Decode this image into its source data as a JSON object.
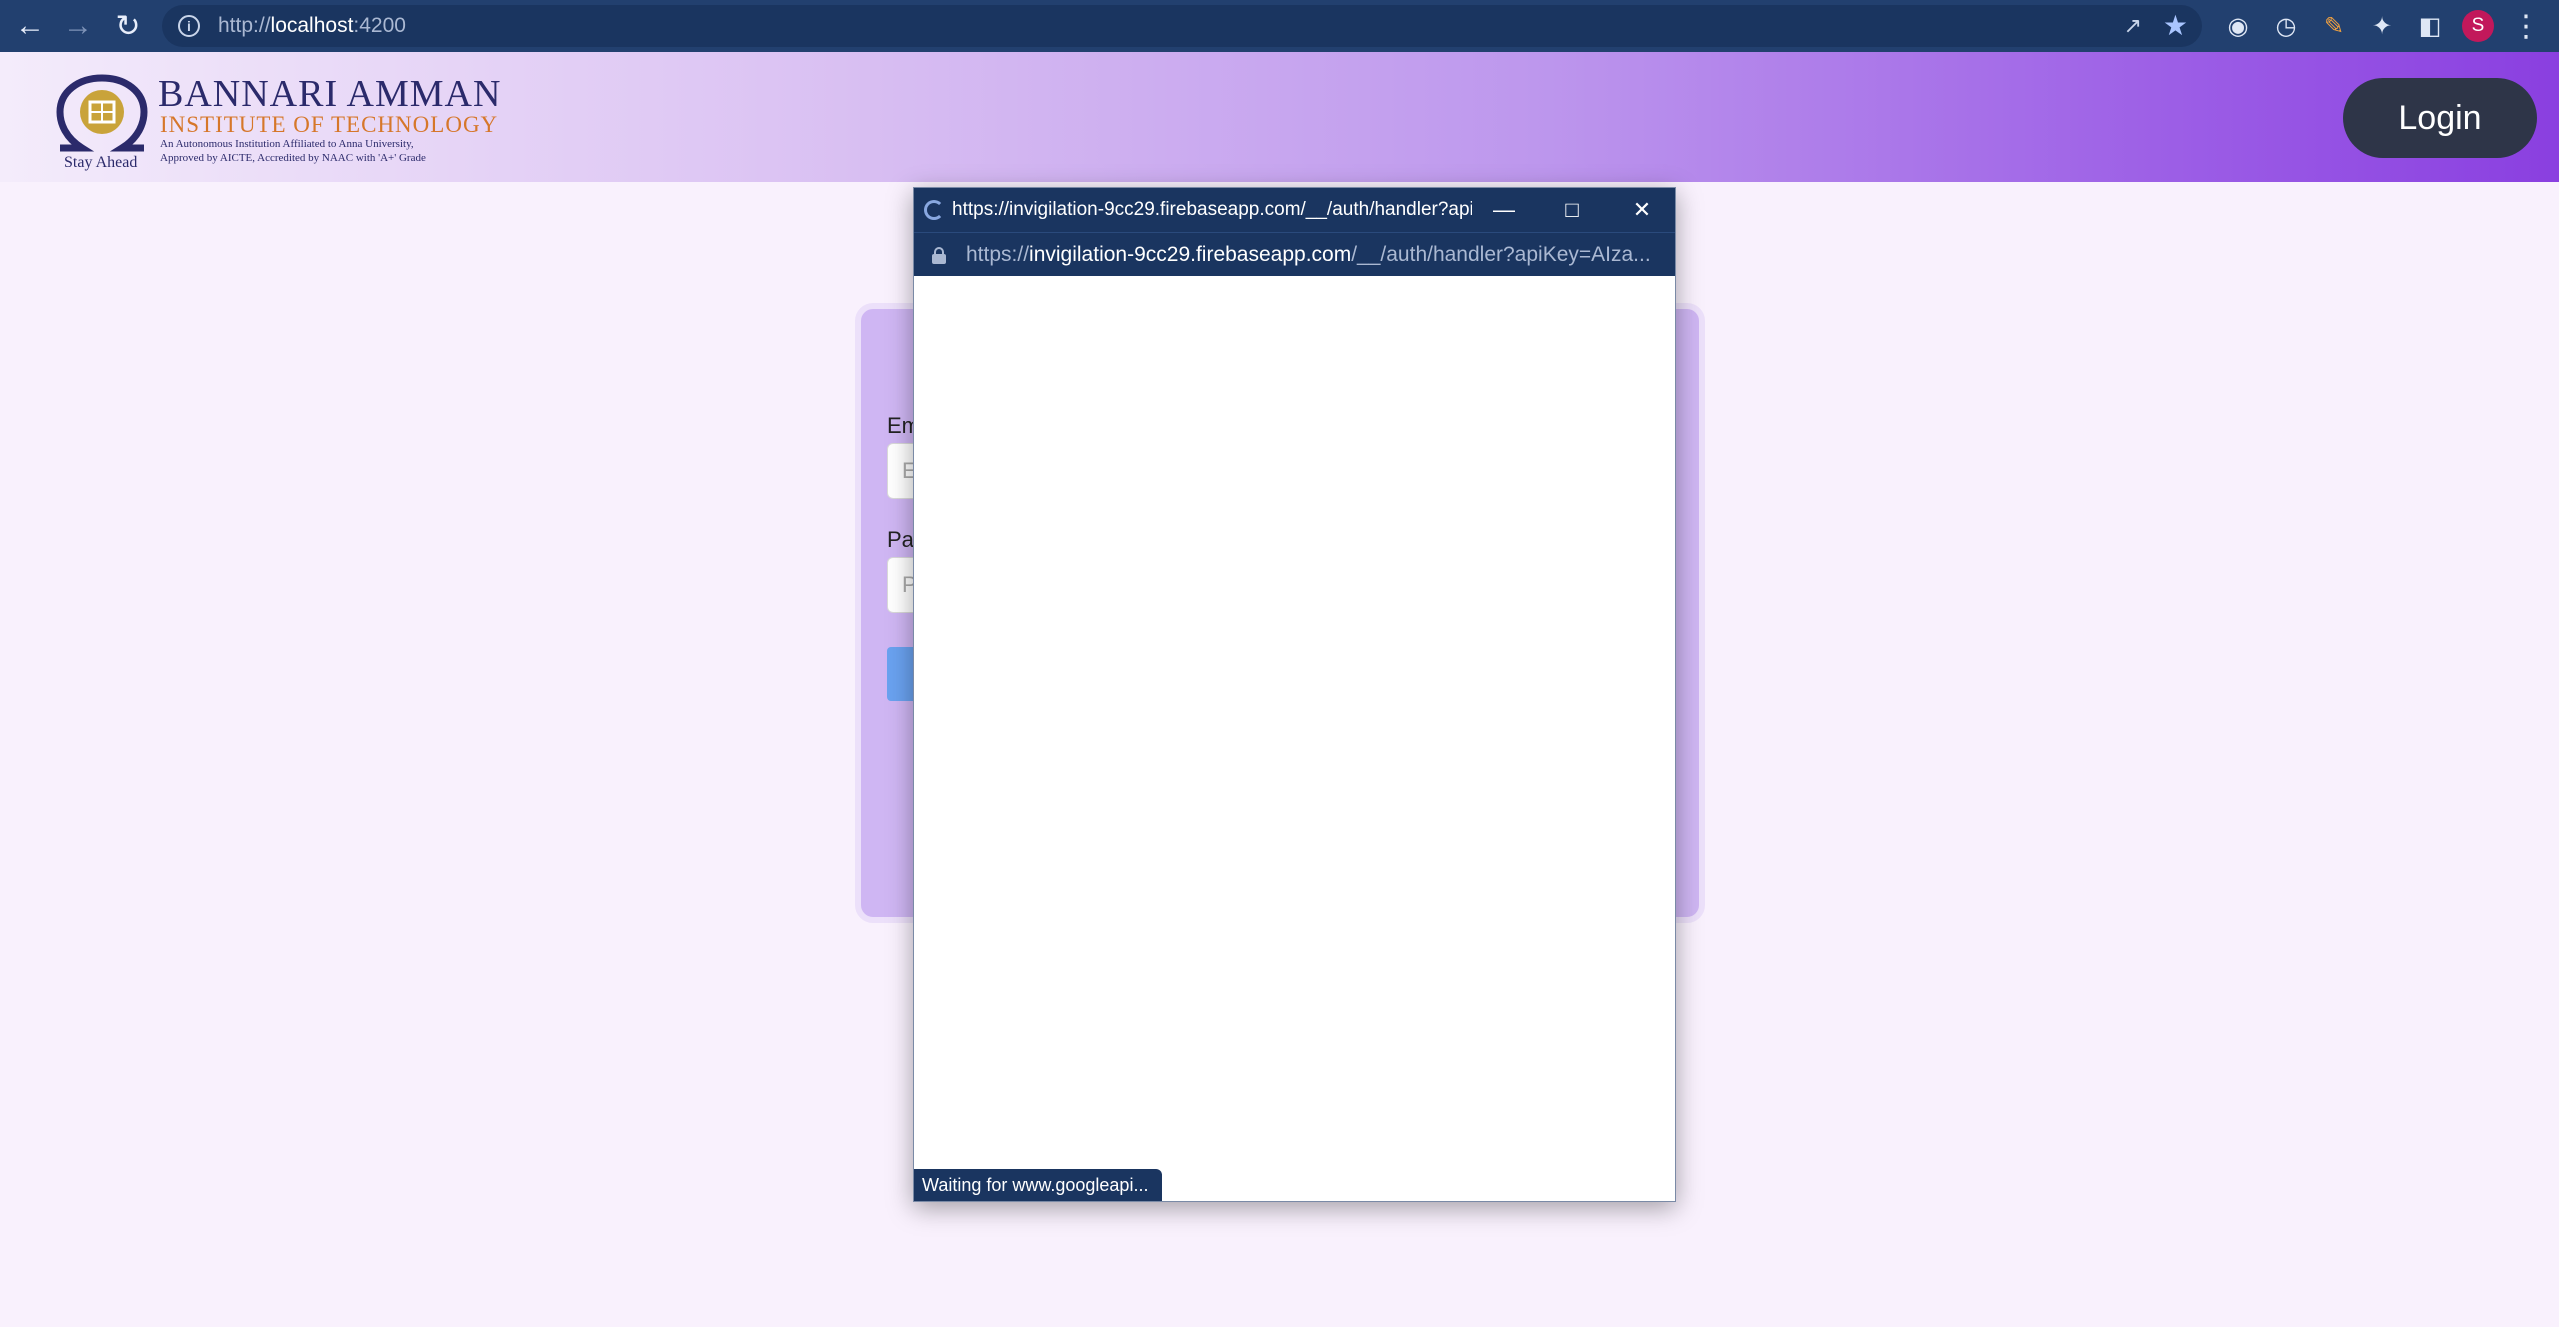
{
  "browser": {
    "url_prefix": "http://",
    "url_host": "localhost",
    "url_port": ":4200",
    "back_icon": "arrow-left-icon",
    "forward_icon": "arrow-right-icon",
    "reload_icon": "reload-icon",
    "avatar_letter": "S"
  },
  "site": {
    "logo_name": "BANNARI AMMAN",
    "logo_sub": "INSTITUTE OF TECHNOLOGY",
    "logo_line1": "An Autonomous Institution Affiliated to Anna University,",
    "logo_line2": "Approved by AICTE, Accredited by NAAC with 'A+' Grade",
    "logo_tag": "Stay Ahead",
    "login_label": "Login"
  },
  "card": {
    "email_label": "Em",
    "email_placeholder": "Er",
    "password_label": "Pas",
    "password_placeholder": "Pe"
  },
  "popup": {
    "title": "https://invigilation-9cc29.firebaseapp.com/__/auth/handler?api...",
    "url_scheme": "https://",
    "url_host": "invigilation-9cc29.firebaseapp.com",
    "url_path": "/__/auth/handler?apiKey=AIza...",
    "status": "Waiting for www.googleapi..."
  },
  "colors": {
    "chrome_bg": "#22406f",
    "header_gradient_end": "#8a3fe0",
    "login_button": "#2e3548",
    "card_bg": "#cfb6f3",
    "submit_button": "#6aa2f0"
  }
}
